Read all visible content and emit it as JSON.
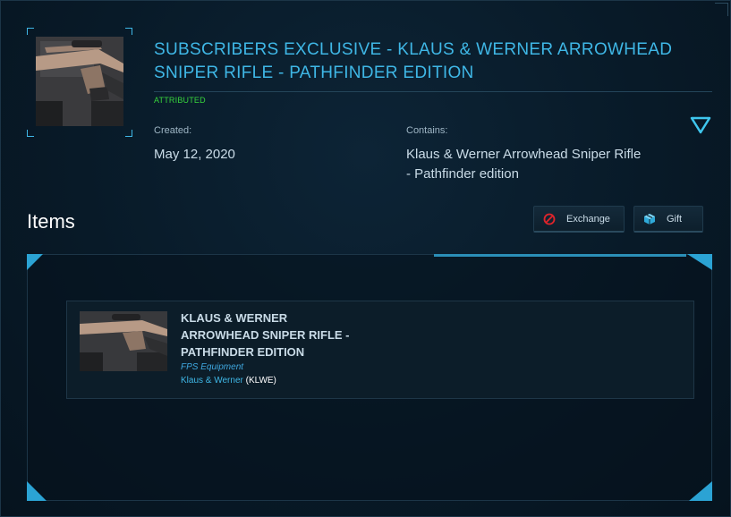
{
  "pledge": {
    "title": "SUBSCRIBERS EXCLUSIVE - KLAUS & WERNER ARROWHEAD SNIPER RIFLE - PATHFINDER EDITION",
    "status": "ATTRIBUTED",
    "created_label": "Created:",
    "created_value": "May 12, 2020",
    "contains_label": "Contains:",
    "contains_value": "Klaus & Werner Arrowhead Sniper Rifle - Pathfinder edition",
    "toggle_icon": "chevron-down-triangle-icon"
  },
  "items_section": {
    "title": "Items",
    "exchange_label": "Exchange",
    "gift_label": "Gift"
  },
  "items": [
    {
      "name": "KLAUS & WERNER ARROWHEAD SNIPER RIFLE - PATHFINDER EDITION",
      "type": "FPS Equipment",
      "manufacturer": "Klaus & Werner",
      "manufacturer_code": "(KLWE)"
    }
  ],
  "colors": {
    "accent": "#3fb7e6",
    "attributed": "#38d43c",
    "background": "#081a28",
    "exchange_icon": "#e0242b"
  }
}
